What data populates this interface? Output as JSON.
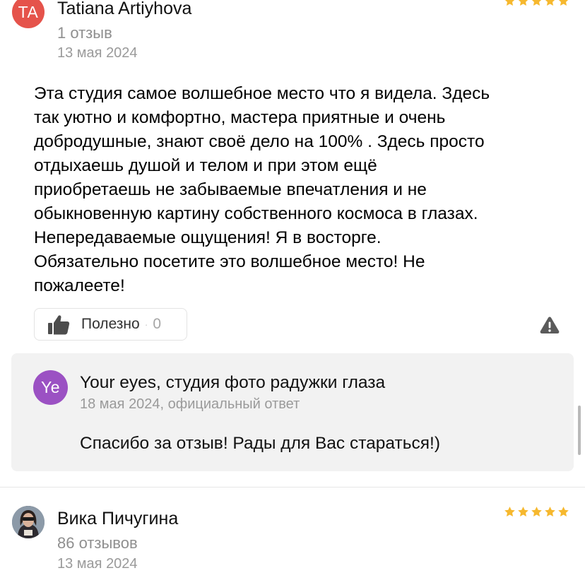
{
  "review1": {
    "avatar_initials": "TA",
    "author": "Tatiana Artiyhova",
    "reviews_count": "1 отзыв",
    "date": "13 мая 2024",
    "rating": 5,
    "text": "Эта студия самое волшебное место что я видела. Здесь\nтак уютно и комфортно, мастера приятные и очень\nдобродушные, знают своё дело на 100% . Здесь просто\nотдыхаешь душой и телом и при этом ещё\nприобретаешь не забываемые впечатления и не\nобыкновенную картину собственного космоса в глазах.\nНепередаваемые ощущения! Я в восторге.\nОбязательно посетите это волшебное место! Не\nпожалеете!",
    "useful_label": "Полезно",
    "useful_separator": "·",
    "useful_count": "0"
  },
  "reply": {
    "avatar_initials": "Ye",
    "org_name": "Your eyes, студия фото радужки глаза",
    "meta": "18 мая 2024, официальный ответ",
    "text": "Спасибо за отзыв! Рады для Вас стараться!)"
  },
  "review2": {
    "author": "Вика Пичугина",
    "reviews_count": "86 отзывов",
    "date": "13 мая 2024",
    "rating": 5
  },
  "colors": {
    "star": "#f6b82e",
    "avatar_ta": "#e5534b",
    "avatar_ye": "#9b51c3",
    "reply_bg": "#f2f2f2"
  }
}
